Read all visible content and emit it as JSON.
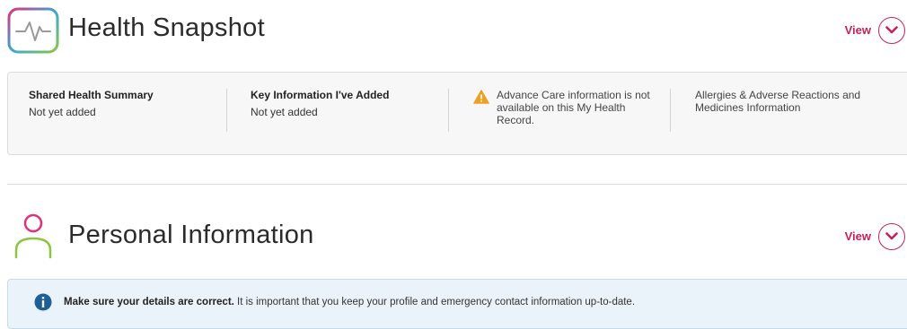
{
  "health_snapshot": {
    "title": "Health Snapshot",
    "icon": "heartbeat-icon",
    "view_label": "View",
    "columns": [
      {
        "title": "Shared Health Summary",
        "value": "Not yet added"
      },
      {
        "title": "Key Information I've Added",
        "value": "Not yet added"
      },
      {
        "icon": "warning-icon",
        "text": "Advance Care information is not available on this My Health Record."
      },
      {
        "text": "Allergies & Adverse Reactions and Medicines Information"
      }
    ]
  },
  "personal_information": {
    "title": "Personal Information",
    "icon": "person-icon",
    "view_label": "View",
    "banner": {
      "icon": "info-icon",
      "bold_text": "Make sure your details are correct.",
      "text": " It is important that you keep your profile and emergency contact information up-to-date."
    }
  },
  "colors": {
    "accent": "#c8215a",
    "banner_bg": "#eaf3fa",
    "info_icon": "#1d5f97",
    "warning_icon": "#f0a020"
  }
}
